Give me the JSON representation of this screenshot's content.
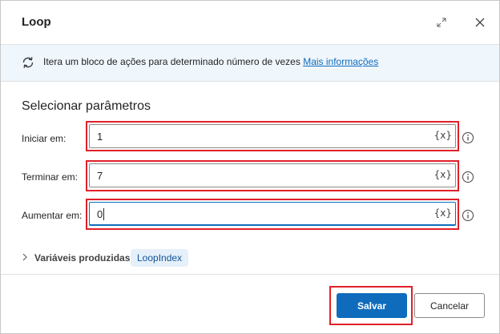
{
  "dialog": {
    "title": "Loop",
    "info_text": "Itera um bloco de ações para determinado número de vezes",
    "info_link": "Mais informações"
  },
  "parameters": {
    "section_title": "Selecionar parâmetros",
    "fields": [
      {
        "label": "Iniciar em:",
        "value": "1",
        "var_button": "{x}"
      },
      {
        "label": "Terminar em:",
        "value": "7",
        "var_button": "{x}"
      },
      {
        "label": "Aumentar em:",
        "value": "0",
        "var_button": "{x}"
      }
    ]
  },
  "produced": {
    "label": "Variáveis produzidas",
    "variable": "LoopIndex"
  },
  "footer": {
    "save_label": "Salvar",
    "cancel_label": "Cancelar"
  },
  "colors": {
    "accent": "#0f6cbd",
    "highlight": "#e0202a",
    "info_background": "#eff6fc",
    "chip_background": "#e6f0fa"
  },
  "icons": {
    "titlebar": [
      "expand-icon",
      "close-icon"
    ],
    "info": "loop-icon",
    "field_help": "info-circle-icon",
    "produced": "chevron-right-icon"
  }
}
